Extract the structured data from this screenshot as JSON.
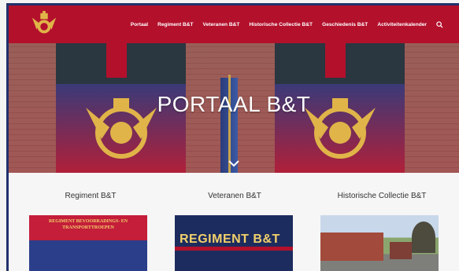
{
  "header": {
    "logo": "regiment-crest-icon",
    "nav": [
      {
        "label": "Portaal"
      },
      {
        "label": "Regiment B&T"
      },
      {
        "label": "Veteranen B&T"
      },
      {
        "label": "Historische Collectie B&T"
      },
      {
        "label": "Geschiedenis B&T"
      },
      {
        "label": "Activiteitenkalender"
      }
    ],
    "search_icon": "search-icon"
  },
  "hero": {
    "title": "PORTAAL B&T",
    "banner_text": "Regiment Bevoorradings- en Transporttroepen",
    "scroll_icon": "chevron-down-icon"
  },
  "cards": [
    {
      "title": "Regiment B&T",
      "image_text": "REGIMENT BEVOORRADINGS- EN TRANSPORTTROEPEN"
    },
    {
      "title": "Veteranen B&T",
      "image_text": "REGIMENT B&T"
    },
    {
      "title": "Historische Collectie B&T",
      "image_text": ""
    }
  ],
  "colors": {
    "brand_red": "#b3102c",
    "navy": "#1d2c5e",
    "gold": "#f2d16b"
  }
}
